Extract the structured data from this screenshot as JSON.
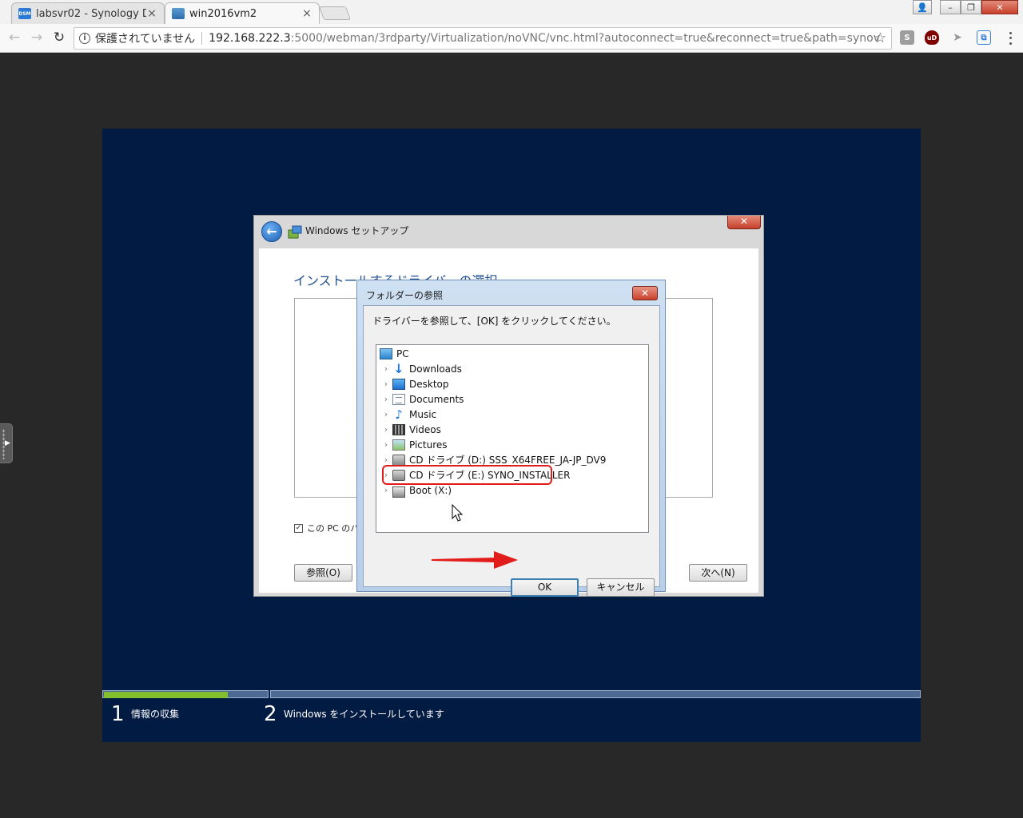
{
  "browser": {
    "tabs": [
      {
        "title": "labsvr02 - Synology D",
        "favicon": "DSM",
        "active": false
      },
      {
        "title": "win2016vm2",
        "active": true
      }
    ],
    "address": {
      "security_text": "保護されていません",
      "host": "192.168.222.3",
      "path": ":5000/webman/3rdparty/Virtualization/noVNC/vnc.html?autoconnect=true&reconnect=true&path=synov"
    },
    "extensions": [
      "S",
      "uD"
    ]
  },
  "setup": {
    "window_title": "Windows セットアップ",
    "heading": "インストールするドライバーの選択",
    "checkbox_label": "この PC のハ",
    "browse_button": "参照(O)",
    "next_button": "次へ(N)"
  },
  "folder_dialog": {
    "title": "フォルダーの参照",
    "instruction": "ドライバーを参照して、[OK] をクリックしてください。",
    "tree": [
      {
        "label": "PC",
        "icon": "pc-icon",
        "level": 0
      },
      {
        "label": "Downloads",
        "icon": "downloads-icon",
        "level": 1
      },
      {
        "label": "Desktop",
        "icon": "desktop-icon",
        "level": 1
      },
      {
        "label": "Documents",
        "icon": "documents-icon",
        "level": 1
      },
      {
        "label": "Music",
        "icon": "music-icon",
        "level": 1
      },
      {
        "label": "Videos",
        "icon": "videos-icon",
        "level": 1
      },
      {
        "label": "Pictures",
        "icon": "pictures-icon",
        "level": 1
      },
      {
        "label": "CD ドライブ (D:) SSS_X64FREE_JA-JP_DV9",
        "icon": "cd-drive-icon",
        "level": 1
      },
      {
        "label": "CD ドライブ (E:) SYNO_INSTALLER",
        "icon": "cd-drive-icon",
        "level": 1,
        "highlighted": true
      },
      {
        "label": "Boot (X:)",
        "icon": "drive-icon",
        "level": 1
      }
    ],
    "ok_button": "OK",
    "cancel_button": "キャンセル"
  },
  "steps": [
    {
      "number": "1",
      "label": "情報の収集"
    },
    {
      "number": "2",
      "label": "Windows をインストールしています"
    }
  ],
  "colors": {
    "screen_bg": "#011b43",
    "progress_fill": "#83bf2d",
    "annotation_red": "#e21b1b"
  }
}
